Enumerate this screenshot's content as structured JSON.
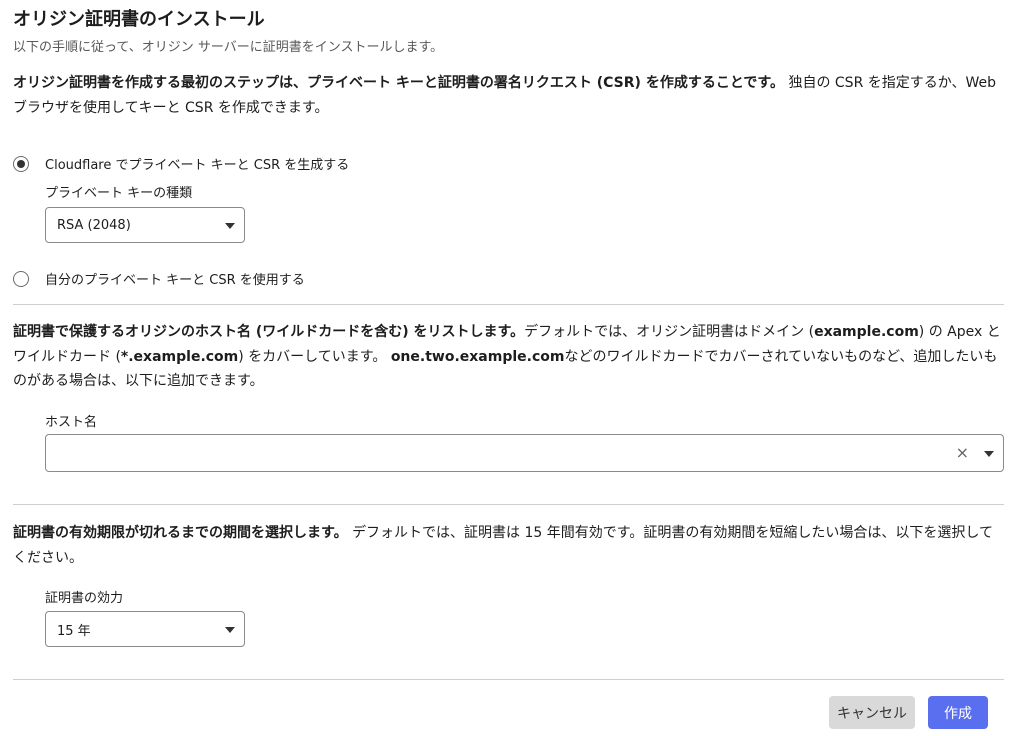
{
  "header": {
    "title": "オリジン証明書のインストール",
    "subtitle": "以下の手順に従って、オリジン サーバーに証明書をインストールします。"
  },
  "csr_section": {
    "intro_bold": "オリジン証明書を作成する最初のステップは、プライベート キーと証明書の署名リクエスト (CSR) を作成することです。",
    "intro_rest": "独自の CSR を指定するか、Web ブラウザを使用してキーと CSR を作成できます。",
    "option_generate": {
      "label": "Cloudflare でプライベート キーと CSR を生成する",
      "selected": true
    },
    "key_type_label": "プライベート キーの種類",
    "key_type_value": "RSA (2048)",
    "option_own": {
      "label": "自分のプライベート キーと CSR を使用する",
      "selected": false
    }
  },
  "hostname_section": {
    "intro_bold": "証明書で保護するオリジンのホスト名 (ワイルドカードを含む) をリストします。",
    "intro_part1": "デフォルトでは、オリジン証明書はドメイン (",
    "domain_bold": "example.com",
    "intro_part2": ") の Apex とワイルドカード (",
    "wildcard_bold": "*.example.com",
    "intro_part3": ") をカバーしています。",
    "example_bold": "one.two.example.com",
    "intro_part4": "などのワイルドカードでカバーされていないものなど、追加したいものがある場合は、以下に追加できます。",
    "field_label": "ホスト名",
    "value": "",
    "clear_symbol": "×"
  },
  "validity_section": {
    "intro_bold": "証明書の有効期限が切れるまでの期間を選択します。",
    "intro_rest": "デフォルトでは、証明書は 15 年間有効です。証明書の有効期間を短縮したい場合は、以下を選択してください。",
    "field_label": "証明書の効力",
    "value": "15 年"
  },
  "footer": {
    "cancel_label": "キャンセル",
    "create_label": "作成"
  },
  "colors": {
    "primary": "#5a6ef0",
    "cancel_bg": "#d9d9d9",
    "divider": "#cfcfcf"
  }
}
